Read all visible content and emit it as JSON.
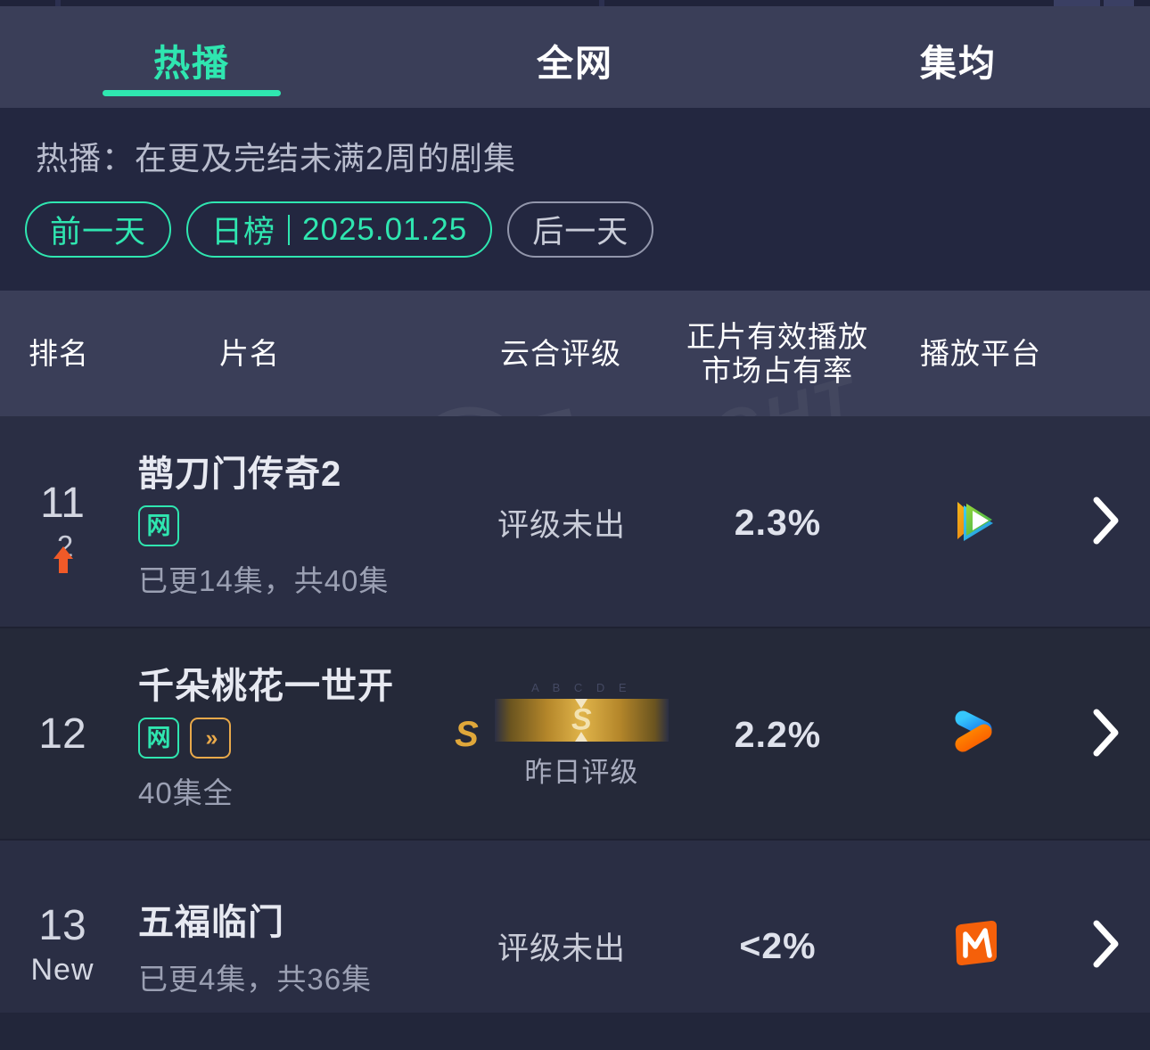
{
  "tabs": [
    {
      "label": "热播",
      "active": true
    },
    {
      "label": "全网",
      "active": false
    },
    {
      "label": "集均",
      "active": false
    }
  ],
  "filter": {
    "subtitle": "热播：在更及完结未满2周的剧集",
    "prev_day": "前一天",
    "rank_type": "日榜",
    "date": "2025.01.25",
    "next_day": "后一天"
  },
  "table": {
    "headers": {
      "rank": "排名",
      "title": "片名",
      "grade": "云合评级",
      "share": "正片有效播放\n市场占有率",
      "platform": "播放平台"
    },
    "rows": [
      {
        "rank": "11",
        "delta": "2",
        "delta_dir": "up",
        "new": "",
        "name": "鹊刀门传奇2",
        "badges": [
          "网"
        ],
        "episodes": "已更14集，共40集",
        "grade_text": "评级未出",
        "grade_bar": false,
        "share": "2.3%",
        "platform": "tencent-video-icon"
      },
      {
        "rank": "12",
        "delta": "",
        "delta_dir": "none",
        "new": "",
        "name": "千朵桃花一世开",
        "badges": [
          "网",
          "ff"
        ],
        "episodes": "40集全",
        "grade_text": "",
        "grade_bar": true,
        "grade_letter": "S",
        "grade_mark": "S",
        "grade_caption": "昨日评级",
        "grade_faint": "A  B  C  D  E",
        "share": "2.2%",
        "platform": "youku-icon"
      },
      {
        "rank": "13",
        "delta": "",
        "delta_dir": "none",
        "new": "New",
        "name": "五福临门",
        "badges": [],
        "episodes": "已更4集，共36集",
        "grade_text": "评级未出",
        "grade_bar": false,
        "share": "<2%",
        "platform": "mango-tv-icon"
      }
    ]
  },
  "watermark": {
    "brand": "ENLIGHT",
    "number": "82508689",
    "at": "@"
  },
  "colors": {
    "accent": "#2fe6b0",
    "up_arrow": "#f05a28",
    "gold": "#e0a73a",
    "tab_bg": "#3a3e58",
    "page_bg": "#272b3d"
  }
}
